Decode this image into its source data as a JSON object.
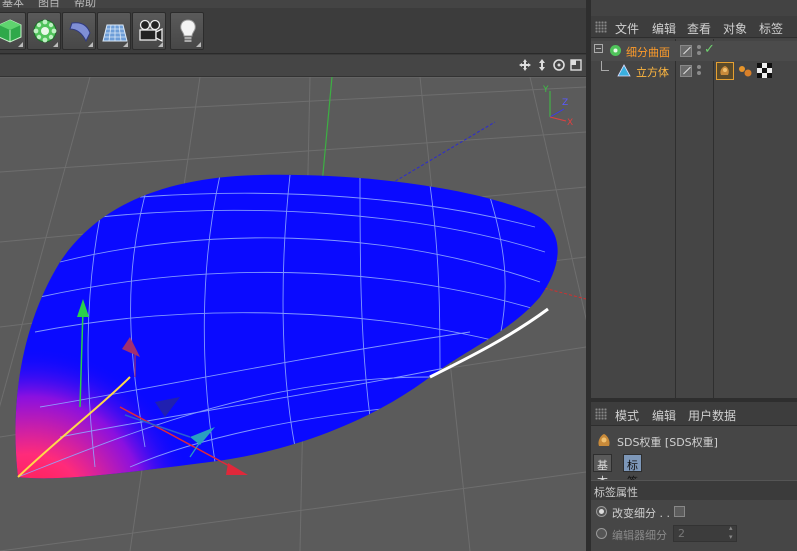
{
  "menubar": {
    "items": [
      "基本",
      "图目",
      "帮助"
    ]
  },
  "toolbar": {
    "tools": [
      {
        "icon": "cube-primitive-icon"
      },
      {
        "icon": "subdivision-generator-icon"
      },
      {
        "icon": "deformer-bend-icon"
      },
      {
        "icon": "floor-scene-icon"
      },
      {
        "icon": "camera-icon"
      },
      {
        "icon": "light-bulb-icon"
      }
    ]
  },
  "viewport": {
    "nav_icons": [
      "move-view-icon",
      "zoom-view-icon",
      "rotate-view-icon",
      "maximize-view-icon"
    ],
    "axis_labels": {
      "y": "Y",
      "z": "Z",
      "x": "X"
    },
    "colors": {
      "background": "#5b5b5b",
      "mesh": "#0a0aff",
      "wire": "#9ab4ff",
      "weight_hot": "#ff1a55"
    }
  },
  "object_manager": {
    "menu": [
      "文件",
      "编辑",
      "查看",
      "对象",
      "标签"
    ],
    "objects": [
      {
        "name": "细分曲面",
        "color": "#ff9c2a",
        "enabled": "✓"
      },
      {
        "name": "立方体",
        "color": "#ffb740"
      }
    ]
  },
  "attribute_manager": {
    "menu": [
      "模式",
      "编辑",
      "用户数据"
    ],
    "title": "SDS权重 [SDS权重]",
    "tabs": [
      "基本",
      "标签"
    ],
    "active_tab": "标签",
    "section": "标签属性",
    "fields": {
      "change_subdiv_label": "改变细分 . .",
      "editor_subdiv_label": "编辑器细分",
      "editor_subdiv_value": "2"
    }
  }
}
